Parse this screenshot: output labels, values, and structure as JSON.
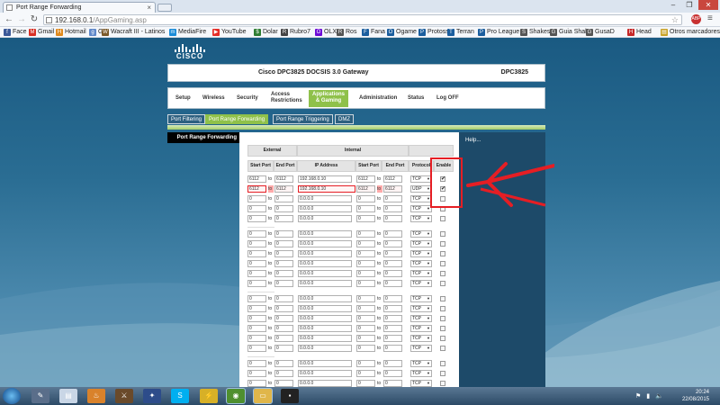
{
  "browser": {
    "tab_title": "Port Range Forwarding",
    "url_host": "192.168.0.1",
    "url_path": "/AppGaming.asp",
    "bookmarks": [
      {
        "label": "Face",
        "icon": "f",
        "color": "#3b5998"
      },
      {
        "label": "Gmail",
        "icon": "M",
        "color": "#d93025"
      },
      {
        "label": "Hotmail",
        "icon": "H",
        "color": "#e08a1e"
      },
      {
        "label": "G",
        "icon": "g",
        "color": "#5f88c9"
      },
      {
        "label": "Wacraft III - Latinos",
        "icon": "W",
        "color": "#7b5a2a"
      },
      {
        "label": "MediaFire",
        "icon": "m",
        "color": "#1b8cd8"
      },
      {
        "label": "YouTube",
        "icon": "▶",
        "color": "#e52d27"
      },
      {
        "label": "Dolar",
        "icon": "$",
        "color": "#2e7d32"
      },
      {
        "label": "Rubro7",
        "icon": "R",
        "color": "#444"
      },
      {
        "label": "OLX",
        "icon": "O",
        "color": "#6e0ad6"
      },
      {
        "label": "Ros",
        "icon": "R",
        "color": "#555"
      },
      {
        "label": "Fana",
        "icon": "F",
        "color": "#1b5e9e"
      },
      {
        "label": "Ogame",
        "icon": "O",
        "color": "#1b5e9e"
      },
      {
        "label": "Protoss",
        "icon": "P",
        "color": "#1b5e9e"
      },
      {
        "label": "Terran",
        "icon": "T",
        "color": "#1b5e9e"
      },
      {
        "label": "Pro League",
        "icon": "P",
        "color": "#1b5e9e"
      },
      {
        "label": "Shakes",
        "icon": "S",
        "color": "#555"
      },
      {
        "label": "Guia Shake",
        "icon": "G",
        "color": "#555"
      },
      {
        "label": "GusaD",
        "icon": "G",
        "color": "#555"
      },
      {
        "label": "Head",
        "icon": "H",
        "color": "#c62828"
      },
      {
        "label": "Otros marcadores",
        "icon": "▤",
        "color": "#c9a227"
      }
    ]
  },
  "router": {
    "brand": "CISCO",
    "title": "Cisco DPC3825 DOCSIS 3.0 Gateway",
    "model": "DPC3825",
    "menu": [
      "Setup",
      "Wireless",
      "Security",
      "Access\nRestrictions",
      "Applications\n& Gaming",
      "Administration",
      "Status",
      "Log OFF"
    ],
    "submenu": [
      "Port Filtering",
      "Port Range Forwarding",
      "Port Range Triggering",
      "DMZ"
    ],
    "page_heading": "Port Range Forwarding",
    "help_link": "Help...",
    "table": {
      "group_external": "External",
      "group_internal": "Internal",
      "col_start_port": "Start Port",
      "col_end_port": "End Port",
      "col_ip": "IP Address",
      "col_protocol": "Protocol",
      "col_enable": "Enable",
      "to_label": "to",
      "rows": [
        {
          "ext_start": "6112",
          "ext_end": "6112",
          "ip": "192.168.0.10",
          "int_start": "6112",
          "int_end": "6112",
          "protocol": "TCP",
          "enabled": true,
          "highlight": false
        },
        {
          "ext_start": "6112",
          "ext_end": "6112",
          "ip": "192.168.0.10",
          "int_start": "6112",
          "int_end": "6112",
          "protocol": "UDP",
          "enabled": true,
          "highlight": true
        },
        {
          "ext_start": "0",
          "ext_end": "0",
          "ip": "0.0.0.0",
          "int_start": "0",
          "int_end": "0",
          "protocol": "TCP",
          "enabled": false,
          "highlight": false
        },
        {
          "ext_start": "0",
          "ext_end": "0",
          "ip": "0.0.0.0",
          "int_start": "0",
          "int_end": "0",
          "protocol": "TCP",
          "enabled": false,
          "highlight": false
        },
        {
          "ext_start": "0",
          "ext_end": "0",
          "ip": "0.0.0.0",
          "int_start": "0",
          "int_end": "0",
          "protocol": "TCP",
          "enabled": false,
          "highlight": false
        },
        {
          "ext_start": "0",
          "ext_end": "0",
          "ip": "0.0.0.0",
          "int_start": "0",
          "int_end": "0",
          "protocol": "TCP",
          "enabled": false,
          "highlight": false
        },
        {
          "ext_start": "0",
          "ext_end": "0",
          "ip": "0.0.0.0",
          "int_start": "0",
          "int_end": "0",
          "protocol": "TCP",
          "enabled": false,
          "highlight": false
        },
        {
          "ext_start": "0",
          "ext_end": "0",
          "ip": "0.0.0.0",
          "int_start": "0",
          "int_end": "0",
          "protocol": "TCP",
          "enabled": false,
          "highlight": false
        },
        {
          "ext_start": "0",
          "ext_end": "0",
          "ip": "0.0.0.0",
          "int_start": "0",
          "int_end": "0",
          "protocol": "TCP",
          "enabled": false,
          "highlight": false
        },
        {
          "ext_start": "0",
          "ext_end": "0",
          "ip": "0.0.0.0",
          "int_start": "0",
          "int_end": "0",
          "protocol": "TCP",
          "enabled": false,
          "highlight": false
        },
        {
          "ext_start": "0",
          "ext_end": "0",
          "ip": "0.0.0.0",
          "int_start": "0",
          "int_end": "0",
          "protocol": "TCP",
          "enabled": false,
          "highlight": false
        },
        {
          "ext_start": "0",
          "ext_end": "0",
          "ip": "0.0.0.0",
          "int_start": "0",
          "int_end": "0",
          "protocol": "TCP",
          "enabled": false,
          "highlight": false
        },
        {
          "ext_start": "0",
          "ext_end": "0",
          "ip": "0.0.0.0",
          "int_start": "0",
          "int_end": "0",
          "protocol": "TCP",
          "enabled": false,
          "highlight": false
        },
        {
          "ext_start": "0",
          "ext_end": "0",
          "ip": "0.0.0.0",
          "int_start": "0",
          "int_end": "0",
          "protocol": "TCP",
          "enabled": false,
          "highlight": false
        },
        {
          "ext_start": "0",
          "ext_end": "0",
          "ip": "0.0.0.0",
          "int_start": "0",
          "int_end": "0",
          "protocol": "TCP",
          "enabled": false,
          "highlight": false
        },
        {
          "ext_start": "0",
          "ext_end": "0",
          "ip": "0.0.0.0",
          "int_start": "0",
          "int_end": "0",
          "protocol": "TCP",
          "enabled": false,
          "highlight": false
        },
        {
          "ext_start": "0",
          "ext_end": "0",
          "ip": "0.0.0.0",
          "int_start": "0",
          "int_end": "0",
          "protocol": "TCP",
          "enabled": false,
          "highlight": false
        },
        {
          "ext_start": "0",
          "ext_end": "0",
          "ip": "0.0.0.0",
          "int_start": "0",
          "int_end": "0",
          "protocol": "TCP",
          "enabled": false,
          "highlight": false
        },
        {
          "ext_start": "0",
          "ext_end": "0",
          "ip": "0.0.0.0",
          "int_start": "0",
          "int_end": "0",
          "protocol": "TCP",
          "enabled": false,
          "highlight": false
        },
        {
          "ext_start": "0",
          "ext_end": "0",
          "ip": "0.0.0.0",
          "int_start": "0",
          "int_end": "0",
          "protocol": "TCP",
          "enabled": false,
          "highlight": false
        },
        {
          "ext_start": "0",
          "ext_end": "0",
          "ip": "0.0.0.0",
          "int_start": "0",
          "int_end": "0",
          "protocol": "TCP",
          "enabled": false,
          "highlight": false
        },
        {
          "ext_start": "0",
          "ext_end": "0",
          "ip": "0.0.0.0",
          "int_start": "0",
          "int_end": "0",
          "protocol": "TCP",
          "enabled": false,
          "highlight": false
        }
      ]
    }
  },
  "annotation": {
    "color": "#e51e24"
  },
  "taskbar": {
    "icons": [
      "start-orb-icon",
      "notes-icon",
      "document-icon",
      "game-icon",
      "warcraft-icon",
      "starcraft-icon",
      "skype-icon",
      "winamp-icon",
      "chrome-icon",
      "explorer-folder-icon",
      "cmd-icon"
    ],
    "time": "20:24",
    "date": "22/08/2015"
  }
}
